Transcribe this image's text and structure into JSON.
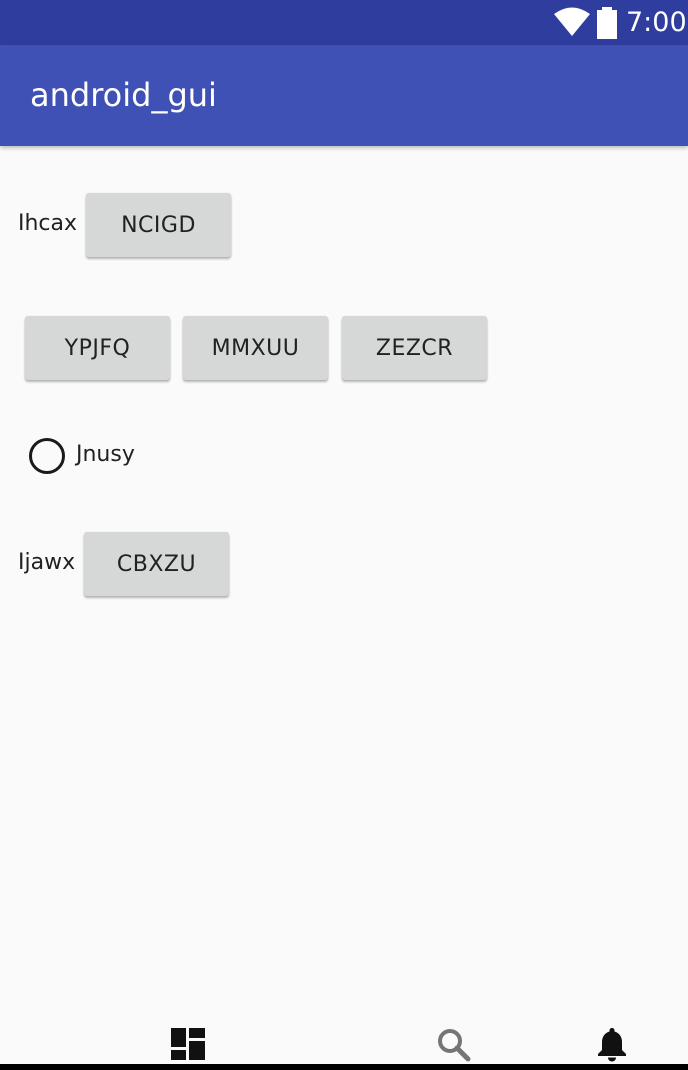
{
  "status_bar": {
    "time": "7:00"
  },
  "app_bar": {
    "title": "android_gui"
  },
  "content": {
    "row1": {
      "label": "Ihcax",
      "button": "NCIGD"
    },
    "row2": {
      "buttons": [
        "YPJFQ",
        "MMXUU",
        "ZEZCR"
      ]
    },
    "radio": {
      "label": "Jnusy",
      "checked": false
    },
    "row3": {
      "label": "Ijawx",
      "button": "CBXZU"
    }
  },
  "bottom_nav": {
    "items": [
      {
        "icon": "dashboard-icon"
      },
      {
        "icon": "search-icon"
      },
      {
        "icon": "bell-icon"
      }
    ]
  },
  "colors": {
    "status_bar": "#2f3d9f",
    "app_bar": "#3f51b5",
    "background": "#fafafa",
    "button": "#d6d7d7"
  }
}
